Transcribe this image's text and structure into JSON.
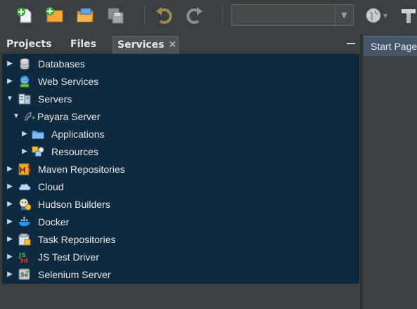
{
  "toolbar": {
    "buttons": [
      {
        "name": "new-file",
        "icon": "new-file-icon"
      },
      {
        "name": "new-project",
        "icon": "new-project-icon"
      },
      {
        "name": "open-project",
        "icon": "open-project-icon"
      },
      {
        "name": "save-all",
        "icon": "save-all-icon"
      },
      {
        "name": "undo",
        "icon": "undo-icon"
      },
      {
        "name": "redo",
        "icon": "redo-icon"
      }
    ],
    "config_combo_value": ""
  },
  "panel": {
    "tabs": [
      "Projects",
      "Files",
      "Services"
    ],
    "active_tab": "Services",
    "close_glyph": "✕"
  },
  "tree": [
    {
      "label": "Databases",
      "icon": "database-icon",
      "expanded": false,
      "level": 0
    },
    {
      "label": "Web Services",
      "icon": "web-services-icon",
      "expanded": false,
      "level": 0
    },
    {
      "label": "Servers",
      "icon": "servers-icon",
      "expanded": true,
      "level": 0
    },
    {
      "label": "Payara Server",
      "icon": "payara-icon",
      "expanded": true,
      "level": 1
    },
    {
      "label": "Applications",
      "icon": "folder-icon",
      "expanded": false,
      "level": 2
    },
    {
      "label": "Resources",
      "icon": "resources-icon",
      "expanded": false,
      "level": 2
    },
    {
      "label": "Maven Repositories",
      "icon": "maven-icon",
      "expanded": false,
      "level": 0
    },
    {
      "label": "Cloud",
      "icon": "cloud-icon",
      "expanded": false,
      "level": 0
    },
    {
      "label": "Hudson Builders",
      "icon": "hudson-icon",
      "expanded": false,
      "level": 0
    },
    {
      "label": "Docker",
      "icon": "docker-icon",
      "expanded": false,
      "level": 0
    },
    {
      "label": "Task Repositories",
      "icon": "task-repo-icon",
      "expanded": false,
      "level": 0
    },
    {
      "label": "JS Test Driver",
      "icon": "js-test-driver-icon",
      "expanded": false,
      "level": 0
    },
    {
      "label": "Selenium Server",
      "icon": "selenium-icon",
      "expanded": false,
      "level": 0
    }
  ],
  "editor": {
    "tab_label": "Start Page"
  }
}
